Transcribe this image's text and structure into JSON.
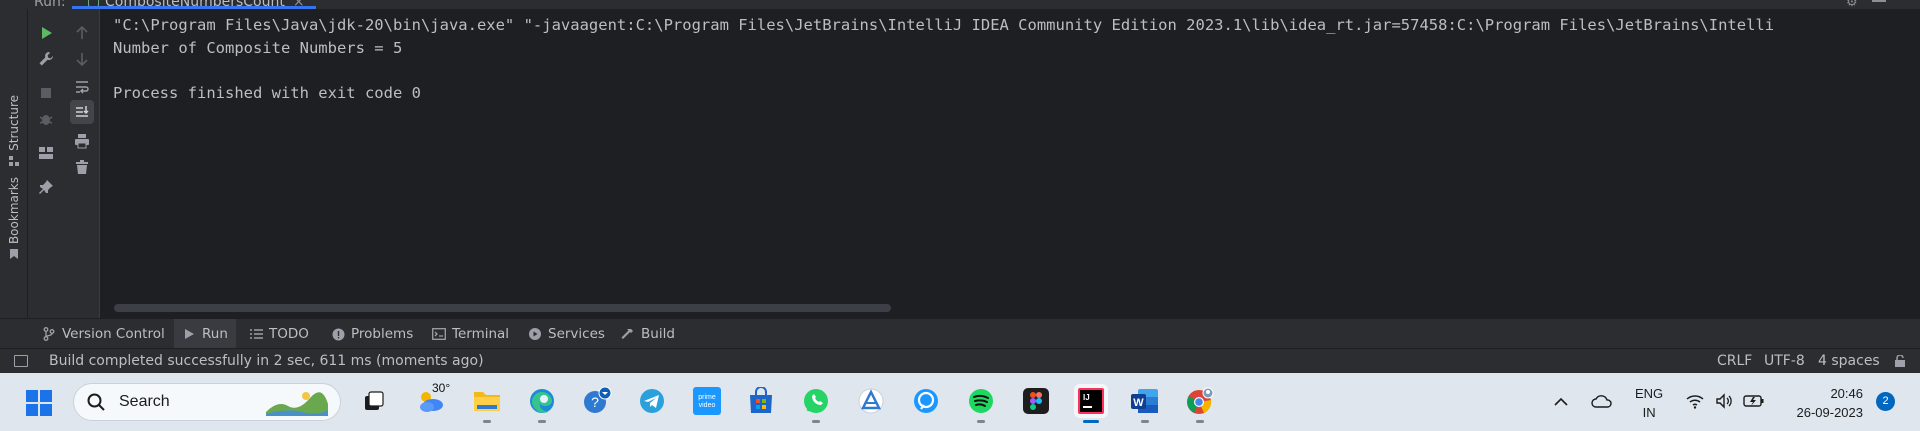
{
  "run_bar": {
    "label": "Run:",
    "tab_label": "CompositeNumbersCount",
    "tab_close": "×"
  },
  "left_stripe": {
    "structure": "Structure",
    "bookmarks": "Bookmarks"
  },
  "console": {
    "lines": [
      "\"C:\\Program Files\\Java\\jdk-20\\bin\\java.exe\" \"-javaagent:C:\\Program Files\\JetBrains\\IntelliJ IDEA Community Edition 2023.1\\lib\\idea_rt.jar=57458:C:\\Program Files\\JetBrains\\Intelli",
      "Number of Composite Numbers = 5",
      "",
      "Process finished with exit code 0"
    ]
  },
  "bottom_tabs": [
    {
      "label": "Version Control",
      "icon": "branch-icon"
    },
    {
      "label": "Run",
      "icon": "run-icon"
    },
    {
      "label": "TODO",
      "icon": "list-icon"
    },
    {
      "label": "Problems",
      "icon": "warning-icon"
    },
    {
      "label": "Terminal",
      "icon": "terminal-icon"
    },
    {
      "label": "Services",
      "icon": "services-icon"
    },
    {
      "label": "Build",
      "icon": "hammer-icon"
    }
  ],
  "status_bar": {
    "message": "Build completed successfully in 2 sec, 611 ms (moments ago)",
    "line_separator": "CRLF",
    "encoding": "UTF-8",
    "indent": "4 spaces"
  },
  "taskbar": {
    "search_placeholder": "Search",
    "weather_temp": "30°",
    "language_line1": "ENG",
    "language_line2": "IN",
    "time": "20:46",
    "date": "26-09-2023",
    "notifications": "2"
  },
  "colors": {
    "accent": "#3574f0",
    "console_bg": "#1e1f22",
    "panel_bg": "#2b2d30",
    "run_green": "#5fb865",
    "taskbar_bg": "#dfe6ee"
  }
}
